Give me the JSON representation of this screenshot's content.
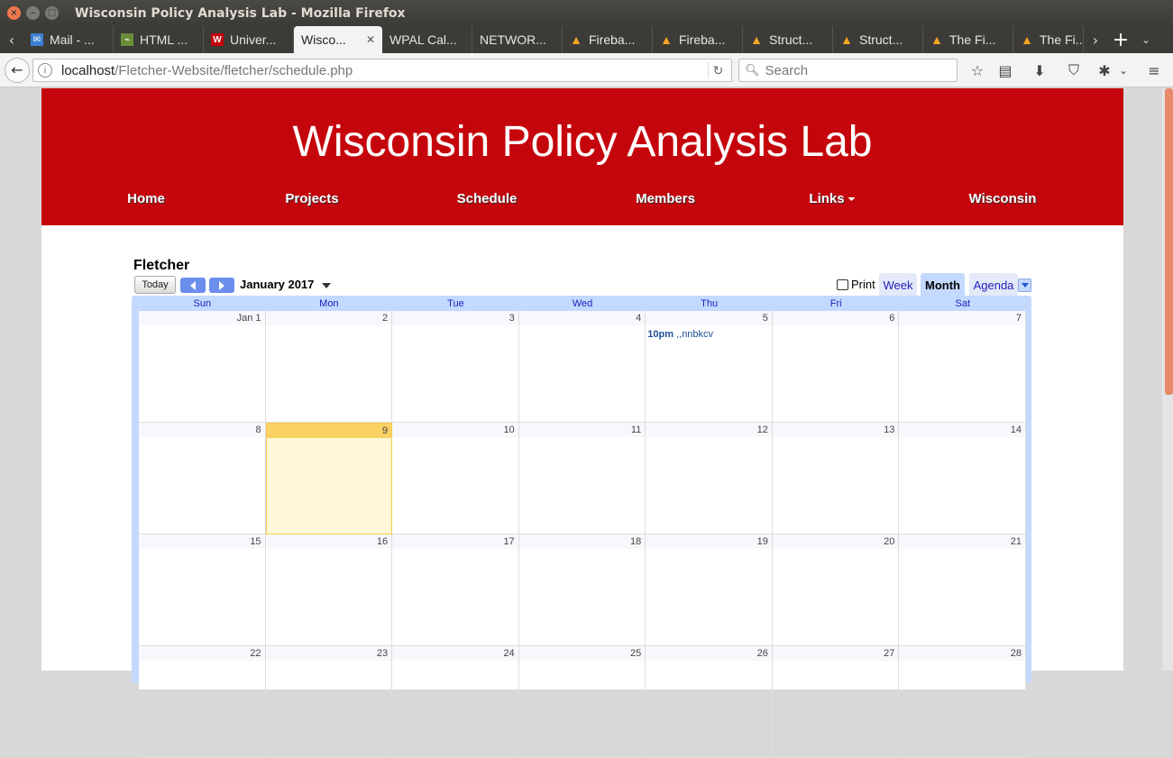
{
  "window": {
    "title": "Wisconsin Policy Analysis Lab - Mozilla Firefox"
  },
  "tabs": [
    {
      "label": "Mail - ...",
      "icon": "mail-icon",
      "color": "#3d7fd3"
    },
    {
      "label": "HTML ...",
      "icon": "html-icon",
      "color": "#6a8d3a"
    },
    {
      "label": "Univer...",
      "icon": "uw-icon",
      "color": "#c5050c"
    },
    {
      "label": "Wisco...",
      "active": true
    },
    {
      "label": "WPAL Cal..."
    },
    {
      "label": "NETWOR..."
    },
    {
      "label": "Fireba...",
      "icon": "firebase-icon",
      "color": "#f5a623"
    },
    {
      "label": "Fireba...",
      "icon": "firebase-icon",
      "color": "#f5a623"
    },
    {
      "label": "Struct...",
      "icon": "firebase-icon",
      "color": "#f5a623"
    },
    {
      "label": "Struct...",
      "icon": "firebase-icon",
      "color": "#f5a623"
    },
    {
      "label": "The Fi...",
      "icon": "firebase-icon",
      "color": "#f5a623"
    },
    {
      "label": "The Fi...",
      "icon": "firebase-icon",
      "color": "#f5a623"
    }
  ],
  "url": {
    "host": "localhost",
    "path": "/Fletcher-Website/fletcher/schedule.php"
  },
  "search": {
    "placeholder": "Search"
  },
  "site": {
    "title": "Wisconsin Policy Analysis Lab",
    "menu": [
      "Home",
      "Projects",
      "Schedule",
      "Members",
      "Links",
      "Wisconsin"
    ],
    "brand_color": "#c5050c"
  },
  "calendar": {
    "name": "Fletcher",
    "today_label": "Today",
    "month_label": "January 2017",
    "print_label": "Print",
    "views": [
      "Week",
      "Month",
      "Agenda"
    ],
    "selected_view": "Month",
    "days_of_week": [
      "Sun",
      "Mon",
      "Tue",
      "Wed",
      "Thu",
      "Fri",
      "Sat"
    ],
    "weeks": [
      [
        "Jan 1",
        "2",
        "3",
        "4",
        "5",
        "6",
        "7"
      ],
      [
        "8",
        "9",
        "10",
        "11",
        "12",
        "13",
        "14"
      ],
      [
        "15",
        "16",
        "17",
        "18",
        "19",
        "20",
        "21"
      ],
      [
        "22",
        "23",
        "24",
        "25",
        "26",
        "27",
        "28"
      ]
    ],
    "today": "9",
    "events": [
      {
        "day": "5",
        "time": "10pm",
        "title": ",,nnbkcv"
      }
    ]
  }
}
